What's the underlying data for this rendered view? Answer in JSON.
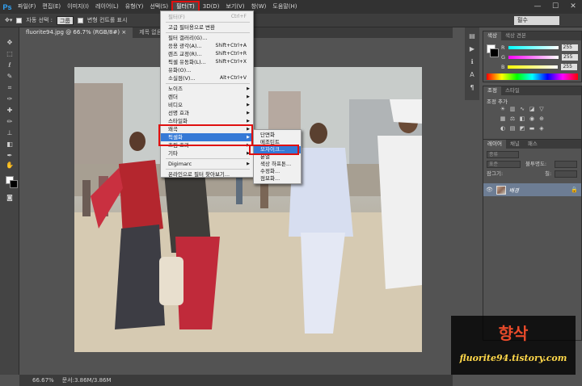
{
  "app": {
    "logo": "Ps"
  },
  "menubar": {
    "items": [
      "파일(F)",
      "편집(E)",
      "이미지(I)",
      "레이어(L)",
      "유형(Y)",
      "선택(S)",
      "필터(T)",
      "3D(D)",
      "보기(V)",
      "창(W)",
      "도움말(H)"
    ],
    "active_index": 6
  },
  "window_controls": [
    "—",
    "☐",
    "✕"
  ],
  "options": {
    "auto_select_label": "자동 선택 :",
    "auto_select_value": "그룹",
    "transform_label": "변형 컨트롤 표시",
    "workspace": "필수"
  },
  "tabs": [
    {
      "label": "fluorite94.jpg @ 66.7% (RGB/8#) ×",
      "active": true
    },
    {
      "label": "제목 없음-1 @ 66.7% (RGB/8#) ×",
      "active": false
    }
  ],
  "status": {
    "zoom": "66.67%",
    "doc": "문서:3.86M/3.86M"
  },
  "color_panel": {
    "tabs": [
      "색상",
      "색상 견본"
    ],
    "channels": [
      {
        "name": "R",
        "value": "255"
      },
      {
        "name": "G",
        "value": "255"
      },
      {
        "name": "B",
        "value": "255"
      }
    ]
  },
  "adj_panel": {
    "tabs": [
      "조정",
      "스타일"
    ],
    "title": "조정 추가"
  },
  "layers_panel": {
    "tabs": [
      "레이어",
      "채널",
      "패스"
    ],
    "kind_label": "종류",
    "blend_mode": "표준",
    "opacity_label": "불투명도:",
    "lock_label": "잠그기:",
    "fill_label": "칠:",
    "layer_name": "배경"
  },
  "filter_menu": {
    "items": [
      {
        "label": "필터(F)",
        "shortcut": "Ctrl+F",
        "disabled": true
      },
      {
        "sep": true
      },
      {
        "label": "고급 필터용으로 변환"
      },
      {
        "sep": true
      },
      {
        "label": "필터 갤러리(G)..."
      },
      {
        "label": "응용 광각(A)...",
        "shortcut": "Shift+Ctrl+A"
      },
      {
        "label": "렌즈 교정(R)...",
        "shortcut": "Shift+Ctrl+R"
      },
      {
        "label": "픽셀 유동화(L)...",
        "shortcut": "Shift+Ctrl+X"
      },
      {
        "label": "유화(O)..."
      },
      {
        "label": "소실점(V)...",
        "shortcut": "Alt+Ctrl+V"
      },
      {
        "sep": true
      },
      {
        "label": "노이즈",
        "sub": true
      },
      {
        "label": "렌더",
        "sub": true
      },
      {
        "label": "비디오",
        "sub": true
      },
      {
        "label": "선명 효과",
        "sub": true
      },
      {
        "label": "스타일화",
        "sub": true
      },
      {
        "label": "왜곡",
        "sub": true
      },
      {
        "label": "픽셀화",
        "sub": true,
        "highlighted": true
      },
      {
        "label": "흐림 효과",
        "sub": true
      },
      {
        "label": "기타",
        "sub": true
      },
      {
        "sep": true
      },
      {
        "label": "Digimarc",
        "sub": true
      },
      {
        "sep": true
      },
      {
        "label": "온라인으로 필터 찾아보기..."
      }
    ]
  },
  "pixelate_menu": {
    "items": [
      {
        "label": "단면화"
      },
      {
        "label": "메조틴트"
      },
      {
        "label": "모자이크...",
        "highlighted": true
      },
      {
        "label": "분열"
      },
      {
        "label": "색상 하프톤..."
      },
      {
        "label": "수정화..."
      },
      {
        "label": "점묘화..."
      }
    ]
  },
  "watermark": {
    "title": "향삭",
    "url": "fluorite94.tistory.com"
  },
  "colors": {
    "highlight": "#3579d6",
    "annotation_red": "#e01010",
    "watermark_title": "#e84a2a",
    "watermark_url": "#ffd84a"
  }
}
